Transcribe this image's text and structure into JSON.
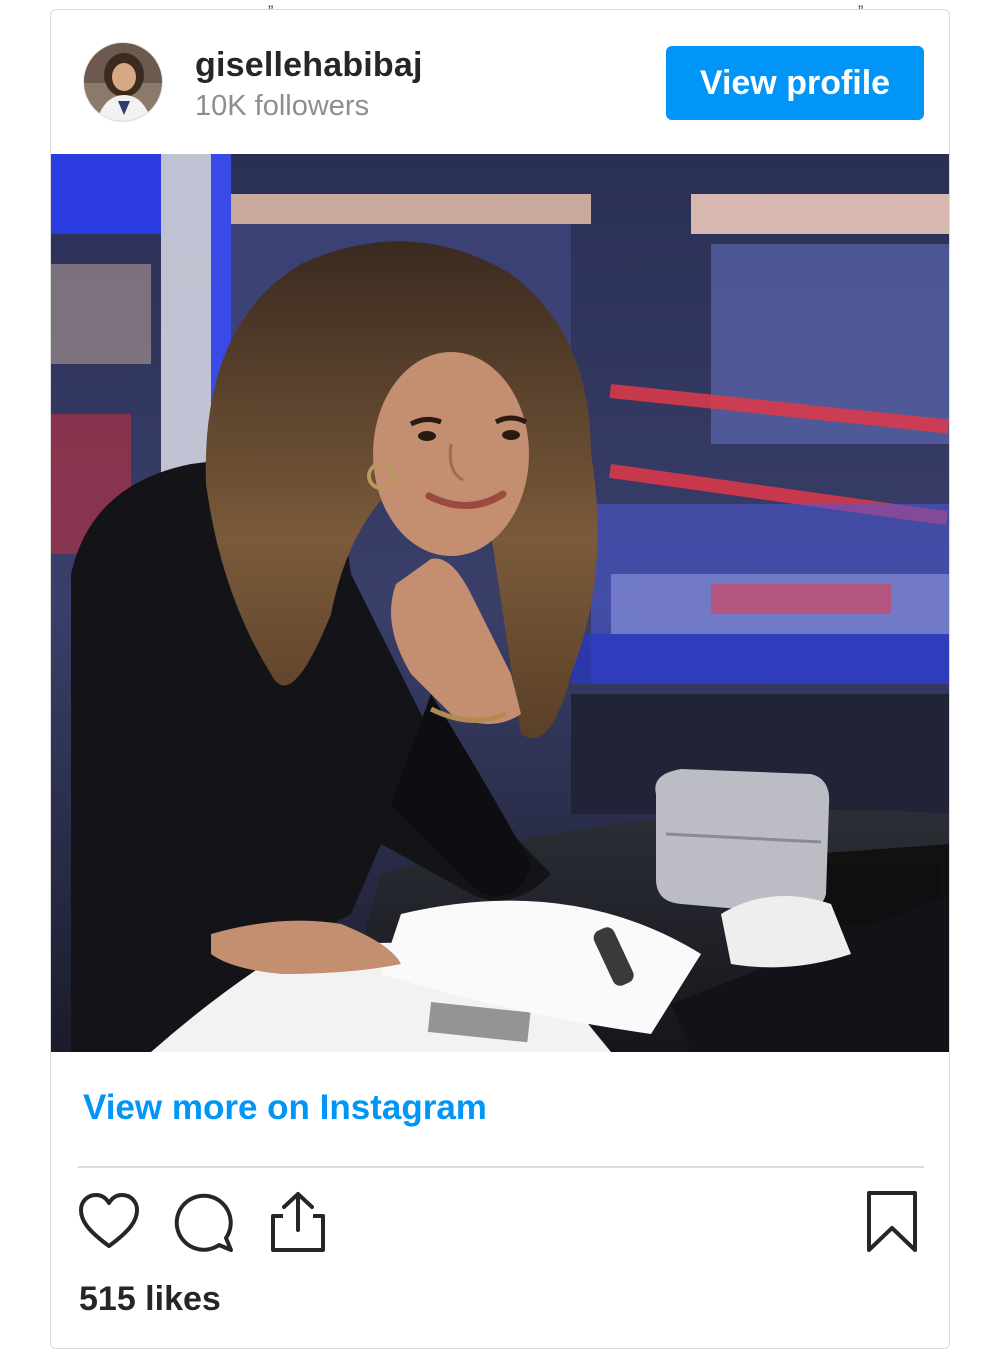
{
  "post": {
    "username": "gisellehabibaj",
    "followers": "10K followers",
    "view_profile_label": "View profile",
    "view_more_label": "View more on Instagram",
    "likes": "515 likes"
  },
  "icons": {
    "like": "heart-icon",
    "comment": "comment-icon",
    "share": "share-icon",
    "save": "bookmark-icon"
  },
  "colors": {
    "accent": "#0095f6",
    "text": "#262626",
    "muted": "#8e8e8e"
  }
}
